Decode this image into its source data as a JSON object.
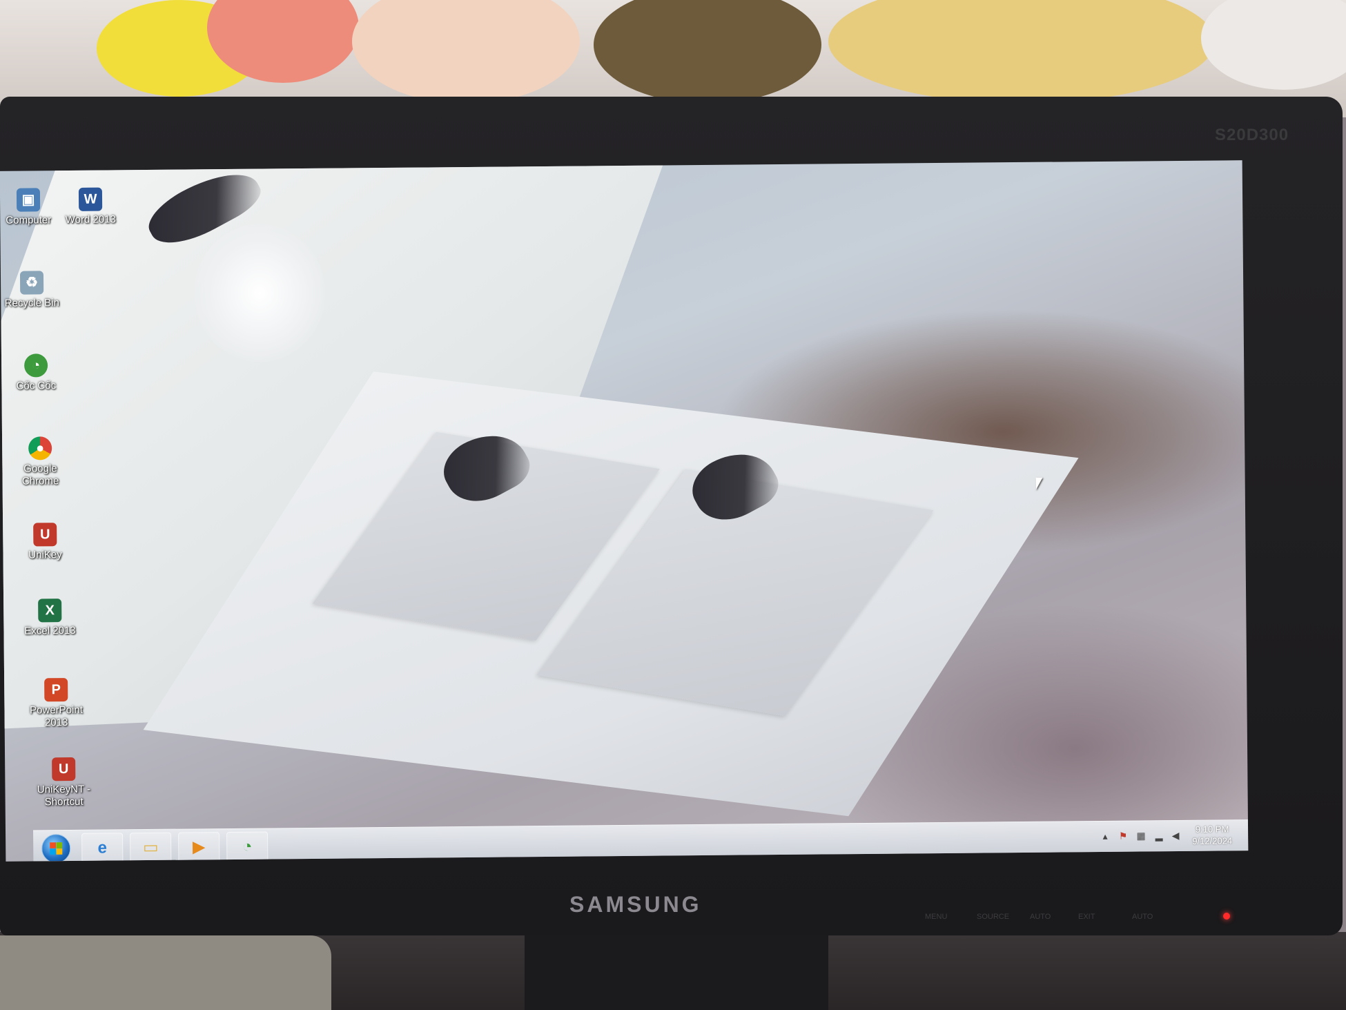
{
  "desktop_icons": [
    {
      "name": "desktop-icon-computer",
      "label": "Computer",
      "icon": "computer-icon",
      "color": "#4a7fb8"
    },
    {
      "name": "desktop-icon-word",
      "label": "Word 2013",
      "icon": "word-icon",
      "color": "#2b579a"
    },
    {
      "name": "desktop-icon-recycle-bin",
      "label": "Recycle Bin",
      "icon": "recycle-bin-icon",
      "color": "#8aa4b8"
    },
    {
      "name": "desktop-icon-coc-coc",
      "label": "Cốc Cốc",
      "icon": "coc-coc-icon",
      "color": "#3d9a3d"
    },
    {
      "name": "desktop-icon-chrome",
      "label": "Google Chrome",
      "icon": "chrome-icon",
      "color": "#db4437"
    },
    {
      "name": "desktop-icon-unikey",
      "label": "UniKey",
      "icon": "unikey-icon",
      "color": "#c0392b"
    },
    {
      "name": "desktop-icon-excel",
      "label": "Excel 2013",
      "icon": "excel-icon",
      "color": "#217346"
    },
    {
      "name": "desktop-icon-powerpoint",
      "label": "PowerPoint 2013",
      "icon": "powerpoint-icon",
      "color": "#d24726"
    },
    {
      "name": "desktop-icon-unikeynt",
      "label": "UniKeyNT - Shortcut",
      "icon": "unikeynt-icon",
      "color": "#c0392b"
    }
  ],
  "taskbar": {
    "start_icon": "windows-start-icon",
    "pinned": [
      {
        "name": "taskbar-internet-explorer",
        "icon": "internet-explorer-icon",
        "glyph": "e"
      },
      {
        "name": "taskbar-file-explorer",
        "icon": "folder-icon",
        "glyph": "▭"
      },
      {
        "name": "taskbar-media-player",
        "icon": "media-player-icon",
        "glyph": "▶"
      },
      {
        "name": "taskbar-coc-coc",
        "icon": "coc-coc-icon",
        "glyph": "◔"
      }
    ],
    "tray_icons": [
      "show-hidden-icons-arrow",
      "action-center-flag-icon",
      "network-icon",
      "signal-icon",
      "volume-icon"
    ],
    "clock": {
      "time": "9:10 PM",
      "date": "9/12/2024"
    }
  },
  "monitor": {
    "brand": "SAMSUNG",
    "model": "S20D300",
    "controls": [
      "MENU",
      "SOURCE",
      "AUTO",
      "EXIT",
      "AUTO"
    ]
  }
}
